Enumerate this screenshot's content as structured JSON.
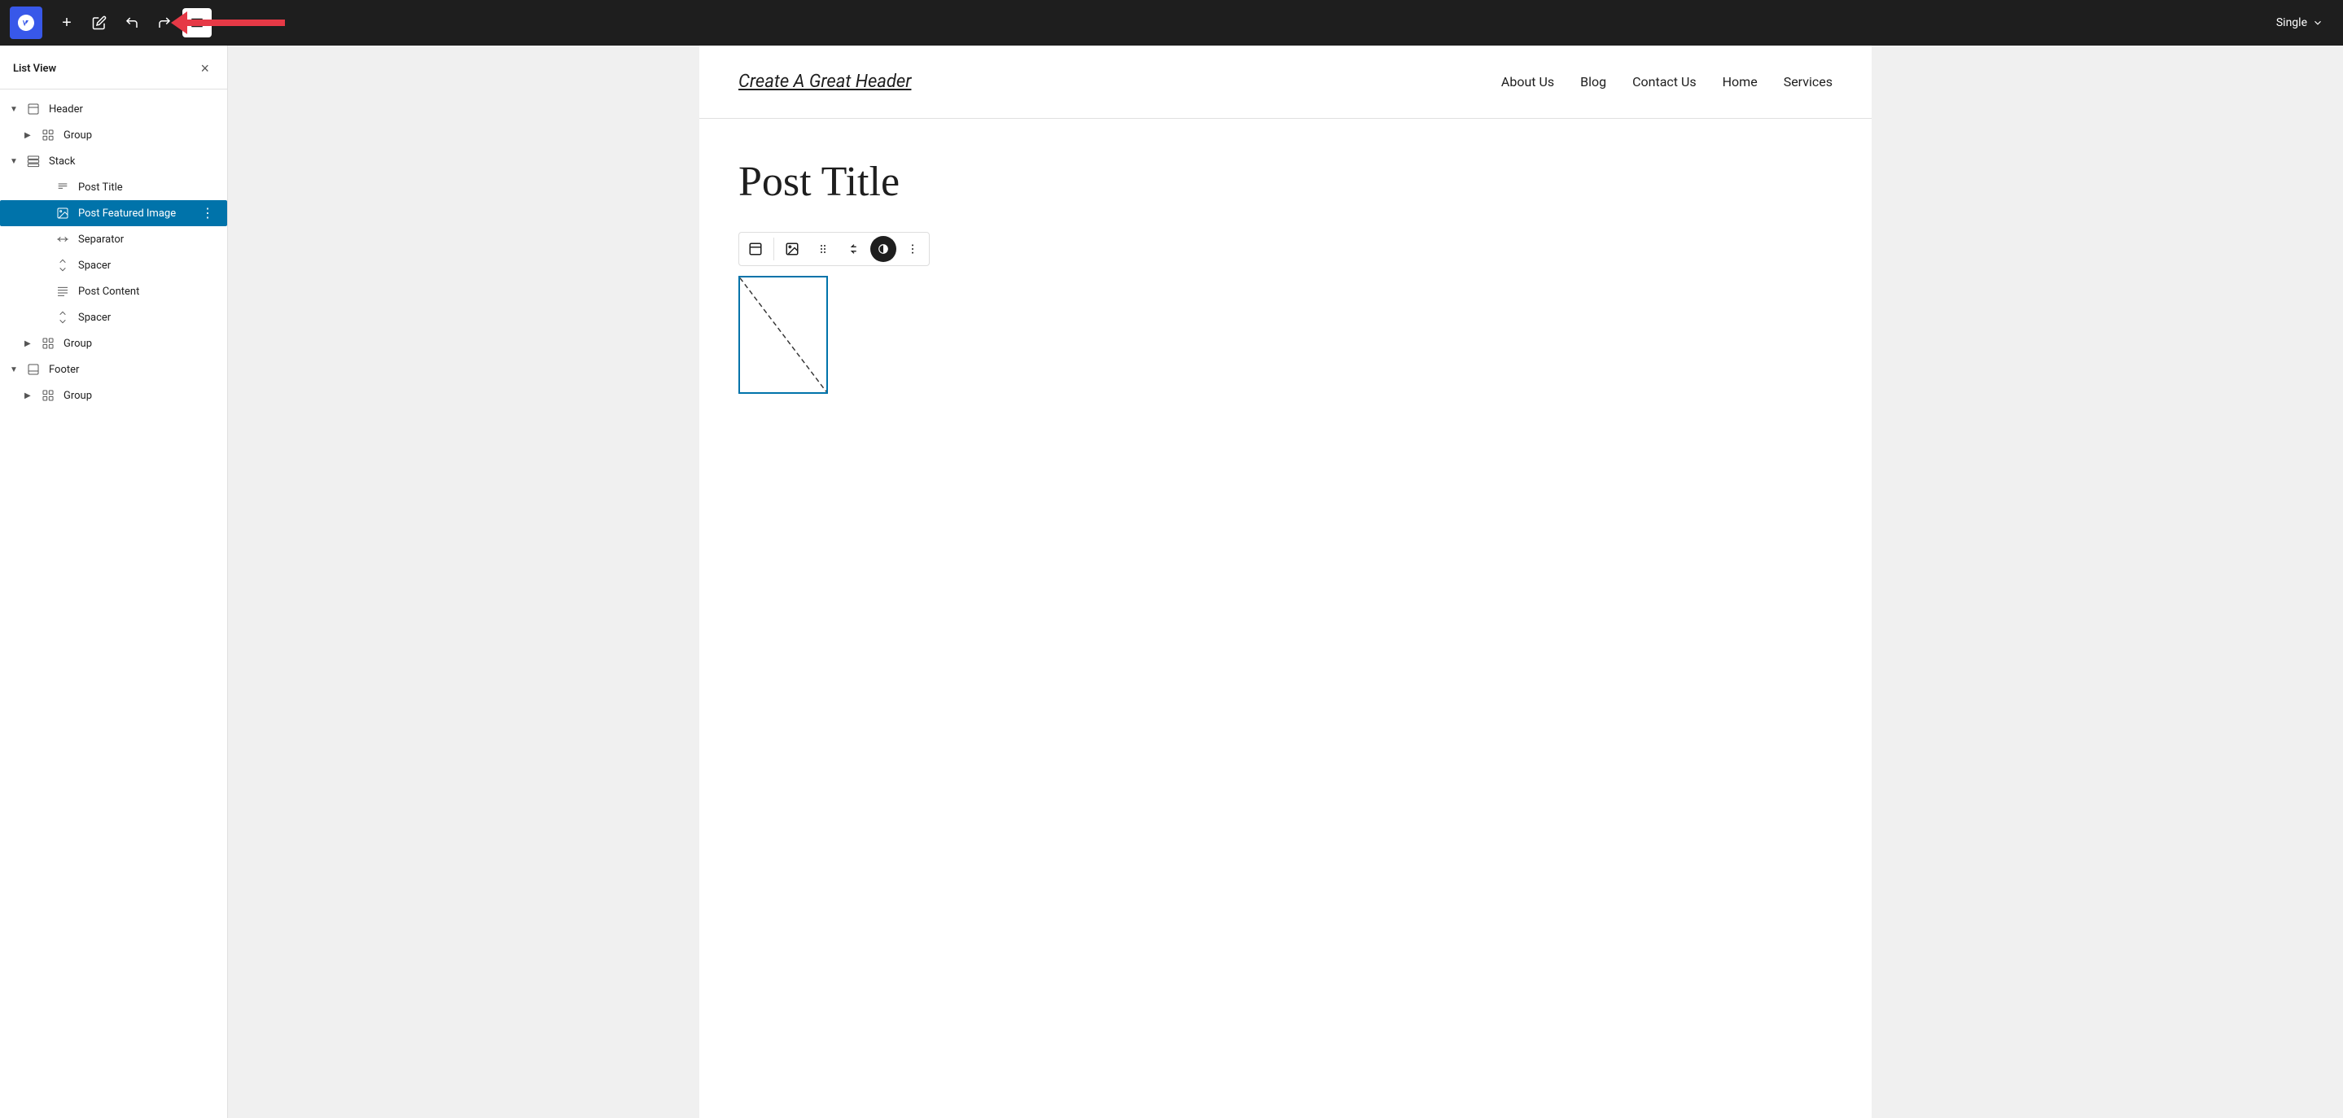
{
  "toolbar": {
    "add_label": "+",
    "edit_label": "✏",
    "undo_label": "↩",
    "redo_label": "↪",
    "list_view_label": "≡",
    "view_mode": "Single"
  },
  "sidebar": {
    "title": "List View",
    "close_label": "×",
    "items": [
      {
        "id": "header",
        "label": "Header",
        "icon": "layout-icon",
        "indent": 0,
        "chevron": "▼",
        "selected": false
      },
      {
        "id": "group1",
        "label": "Group",
        "icon": "group-icon",
        "indent": 1,
        "chevron": "▶",
        "selected": false
      },
      {
        "id": "stack",
        "label": "Stack",
        "icon": "stack-icon",
        "indent": 0,
        "chevron": "▼",
        "selected": false
      },
      {
        "id": "post-title",
        "label": "Post Title",
        "icon": "title-icon",
        "indent": 2,
        "chevron": "",
        "selected": false
      },
      {
        "id": "post-featured-image",
        "label": "Post Featured Image",
        "icon": "image-icon",
        "indent": 2,
        "chevron": "",
        "selected": true
      },
      {
        "id": "separator",
        "label": "Separator",
        "icon": "separator-icon",
        "indent": 2,
        "chevron": "",
        "selected": false
      },
      {
        "id": "spacer1",
        "label": "Spacer",
        "icon": "spacer-icon",
        "indent": 2,
        "chevron": "",
        "selected": false
      },
      {
        "id": "post-content",
        "label": "Post Content",
        "icon": "content-icon",
        "indent": 2,
        "chevron": "",
        "selected": false
      },
      {
        "id": "spacer2",
        "label": "Spacer",
        "icon": "spacer-icon",
        "indent": 2,
        "chevron": "",
        "selected": false
      },
      {
        "id": "group2",
        "label": "Group",
        "icon": "group-icon",
        "indent": 1,
        "chevron": "▶",
        "selected": false
      },
      {
        "id": "footer",
        "label": "Footer",
        "icon": "footer-icon",
        "indent": 0,
        "chevron": "▼",
        "selected": false
      },
      {
        "id": "group3",
        "label": "Group",
        "icon": "group-icon",
        "indent": 1,
        "chevron": "▶",
        "selected": false
      }
    ]
  },
  "canvas": {
    "site_title": "Create A Great Header",
    "nav_items": [
      "About Us",
      "Blog",
      "Contact Us",
      "Home",
      "Services"
    ],
    "post_title": "Post Title",
    "block_toolbar": {
      "buttons": [
        "H",
        "⊞",
        "⋮⋮",
        "⌃⌄",
        "●",
        "⋮"
      ]
    }
  }
}
